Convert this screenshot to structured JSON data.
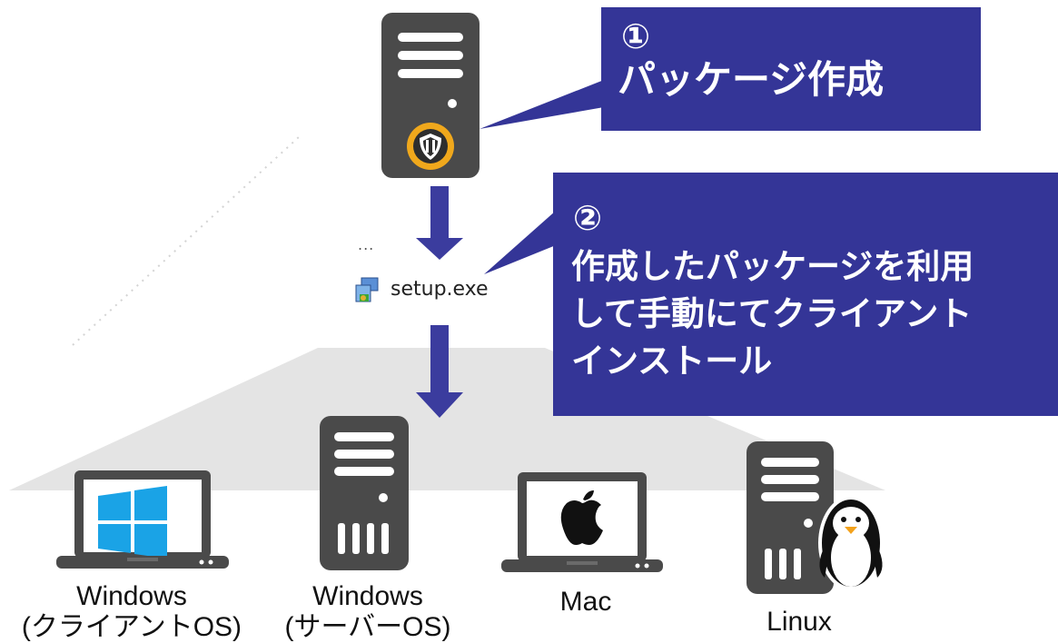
{
  "callouts": [
    {
      "number": "①",
      "text": "パッケージ作成"
    },
    {
      "number": "②",
      "text": "作成したパッケージを利用\nして手動にてクライアント\nインストール"
    }
  ],
  "file": {
    "name": "setup.exe",
    "partial_label": "..."
  },
  "devices": [
    {
      "label": "Windows\n(クライアントOS)",
      "icon": "windows-laptop-icon"
    },
    {
      "label": "Windows\n(サーバーOS)",
      "icon": "server-tower-icon"
    },
    {
      "label": "Mac",
      "icon": "mac-laptop-icon"
    },
    {
      "label": "Linux",
      "icon": "linux-server-icon"
    }
  ],
  "colors": {
    "callout_bg": "#343597",
    "arrow": "#3b3c9e",
    "device_gray": "#4a4a4a",
    "shield_ring": "#f0a81c",
    "windows_blue": "#1aa3e6"
  }
}
